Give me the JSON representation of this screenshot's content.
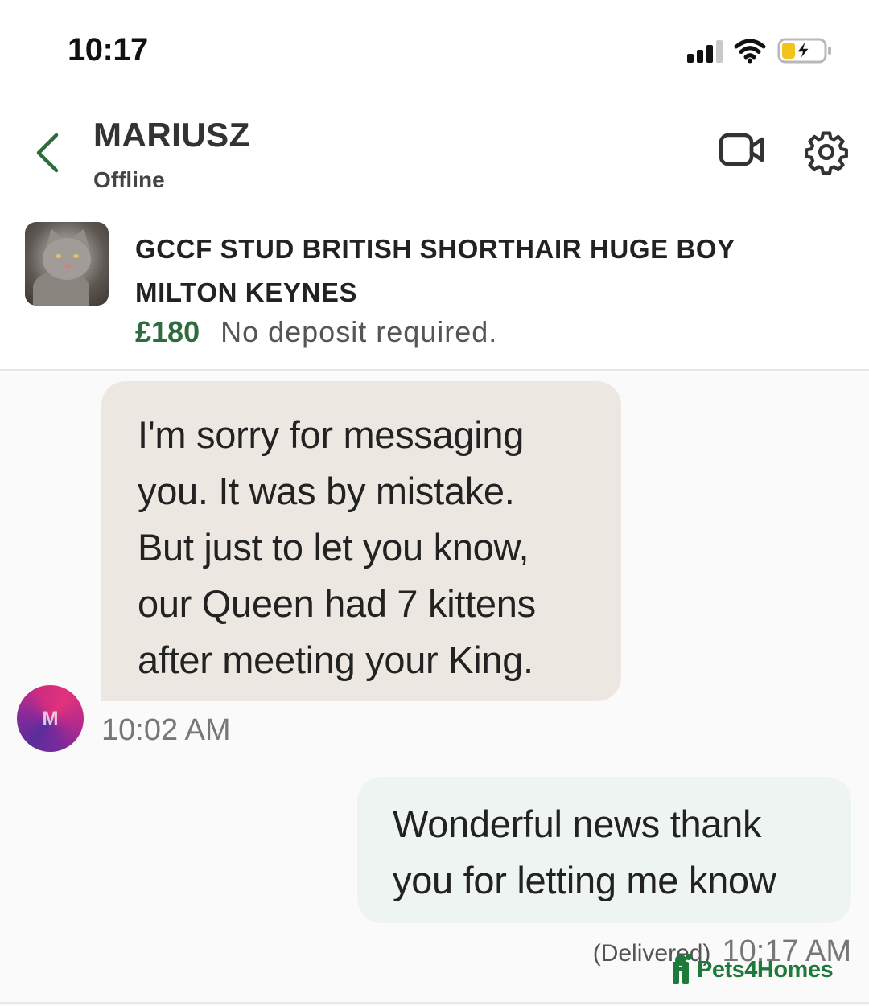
{
  "status_bar": {
    "time": "10:17"
  },
  "header": {
    "contact_name": "MARIUSZ",
    "contact_status": "Offline"
  },
  "listing": {
    "title_line1": "GCCF STUD BRITISH SHORTHAIR HUGE BOY",
    "title_line2": "MILTON KEYNES",
    "price": "£180",
    "note": "No deposit required."
  },
  "messages": [
    {
      "direction": "incoming",
      "lines": [
        "I'm sorry for messaging",
        "you. It was by mistake.",
        "But just to let you know,",
        "our Queen had 7 kittens",
        "after meeting your King."
      ],
      "time": "10:02 AM",
      "avatar_initial": "M"
    },
    {
      "direction": "outgoing",
      "lines": [
        "Wonderful news thank",
        "you for letting me know"
      ],
      "status": "(Delivered)",
      "time": "10:17 AM"
    }
  ],
  "watermark": {
    "brand": "Pets4Homes"
  },
  "colors": {
    "accent_green": "#2e6b3d",
    "incoming_bubble": "#ece8e1",
    "outgoing_bubble": "#eef4f1",
    "battery_charging": "#f2c31a"
  },
  "icons": {
    "back": "chevron-left-icon",
    "video": "video-camera-icon",
    "settings": "gear-icon",
    "signal": "cellular-signal-icon",
    "wifi": "wifi-icon",
    "battery": "battery-charging-icon"
  }
}
